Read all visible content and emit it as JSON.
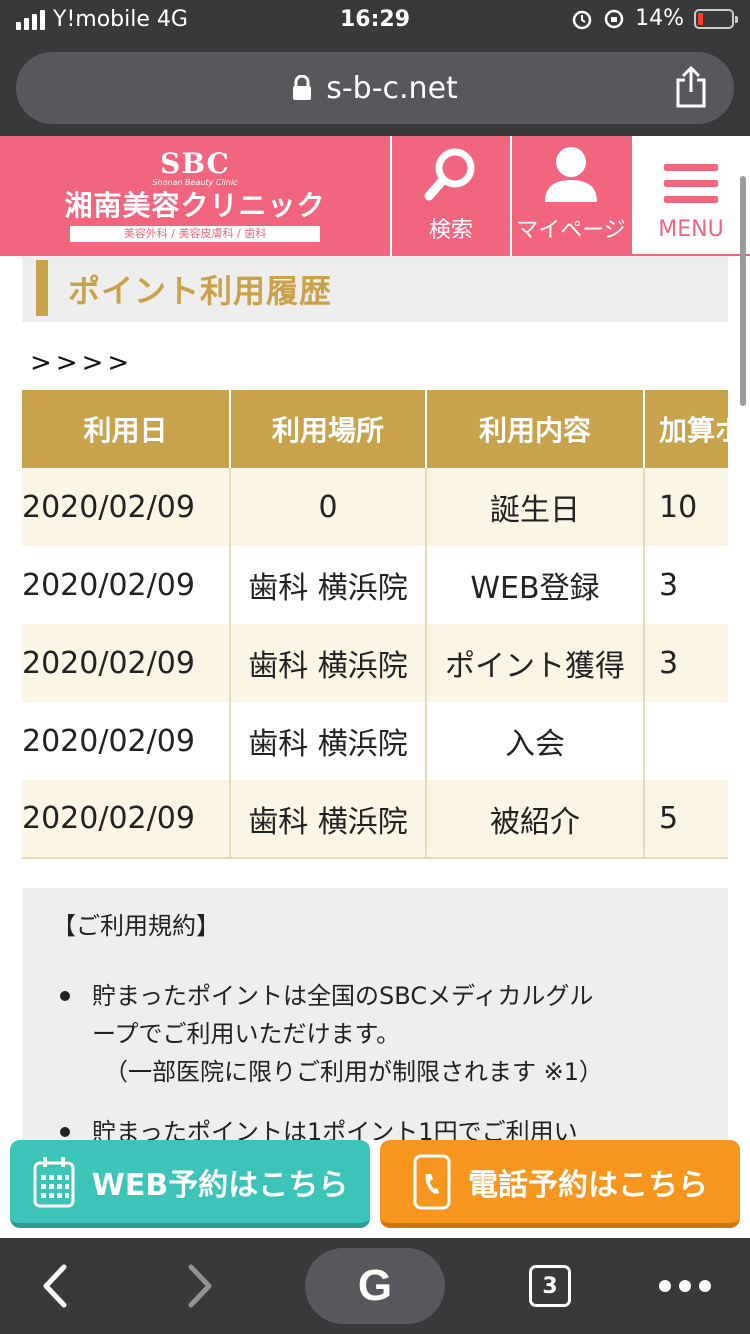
{
  "status_bar": {
    "carrier": "Y!mobile 4G",
    "time": "16:29",
    "battery": "14%"
  },
  "browser": {
    "url": "s-b-c.net",
    "tab_count": "3",
    "google_label": "G"
  },
  "header": {
    "logo_brand": "SBC",
    "logo_sub": "Shonan Beauty Clinic",
    "logo_name": "湘南美容クリニック",
    "logo_tagline": "美容外科 / 美容皮膚科 / 歯科",
    "search_label": "検索",
    "mypage_label": "マイページ",
    "menu_label": "MENU"
  },
  "page": {
    "title": "ポイント利用履歴",
    "breadcrumb": ">>>>"
  },
  "table": {
    "headers": [
      "利用日",
      "利用場所",
      "利用内容",
      "加算ポ"
    ],
    "rows": [
      {
        "date": "2020/02/09",
        "place": "0",
        "content": "誕生日",
        "points": "10"
      },
      {
        "date": "2020/02/09",
        "place": "歯科 横浜院",
        "content": "WEB登録",
        "points": "3"
      },
      {
        "date": "2020/02/09",
        "place": "歯科 横浜院",
        "content": "ポイント獲得",
        "points": "3"
      },
      {
        "date": "2020/02/09",
        "place": "歯科 横浜院",
        "content": "入会",
        "points": ""
      },
      {
        "date": "2020/02/09",
        "place": "歯科 横浜院",
        "content": "被紹介",
        "points": "5"
      }
    ]
  },
  "terms": {
    "heading": "【ご利用規約】",
    "item1_line1": "貯まったポイントは全国のSBCメディカルグル",
    "item1_line2": "ープでご利用いただけます。",
    "item1_note": "（一部医院に限りご利用が制限されます ※1）",
    "item2_line1": "貯まったポイントは1ポイント1円でご利用い"
  },
  "cta": {
    "web_label": "WEB予約はこちら",
    "tel_label": "電話予約はこちら"
  },
  "colors": {
    "brand_pink": "#f2657e",
    "gold": "#c9a24c",
    "web_teal": "#3cc4b8",
    "tel_orange": "#f6961f"
  }
}
